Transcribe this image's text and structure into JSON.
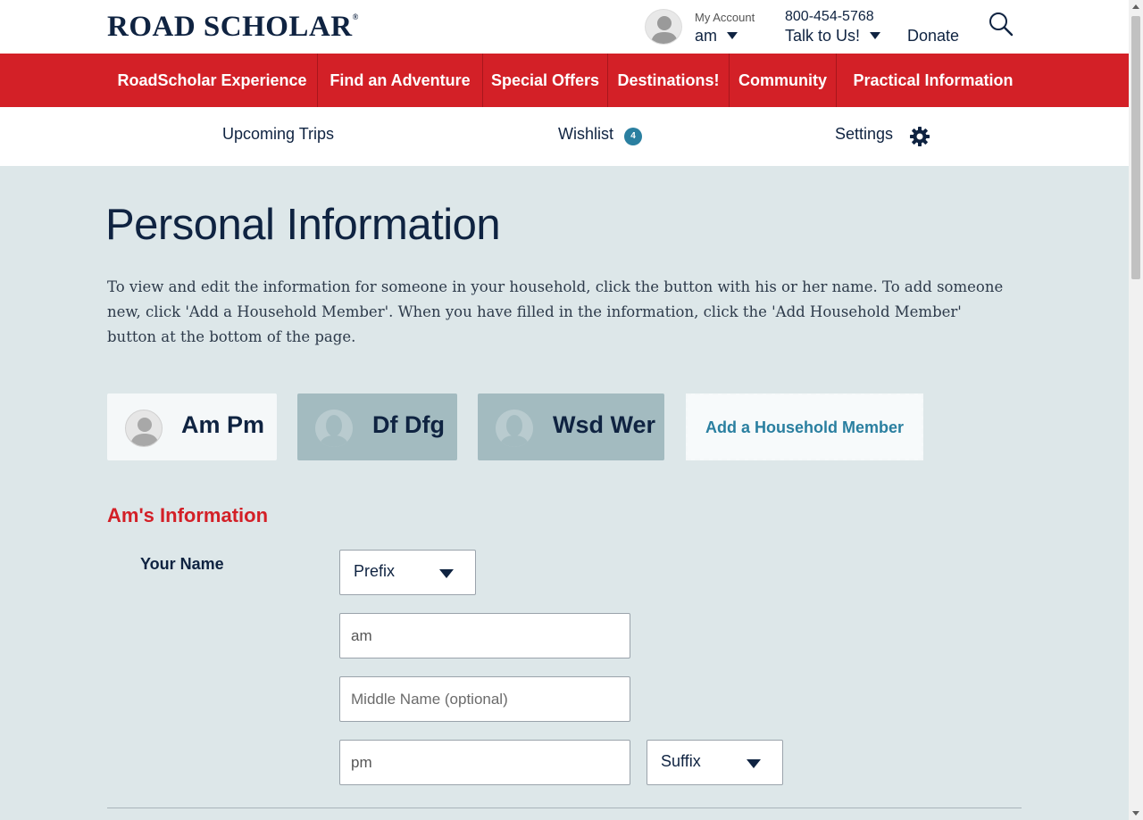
{
  "header": {
    "logo_text": "ROAD SCHOLAR",
    "logo_mark": "®",
    "account": {
      "label": "My Account",
      "name": "am",
      "avatar_icon": "user-silhouette-icon"
    },
    "phone": "800-454-5768",
    "talk_label": "Talk to Us!",
    "donate_label": "Donate",
    "search_icon": "search-icon"
  },
  "nav": {
    "items": [
      {
        "label": "RoadScholar Experience"
      },
      {
        "label": "Find an Adventure"
      },
      {
        "label": "Special Offers"
      },
      {
        "label": "Destinations!"
      },
      {
        "label": "Community"
      },
      {
        "label": "Practical Information"
      }
    ],
    "color": "#d32027"
  },
  "subnav": {
    "upcoming": "Upcoming Trips",
    "wishlist": "Wishlist",
    "wishlist_count": "4",
    "settings": "Settings"
  },
  "page": {
    "title": "Personal Information",
    "intro": "To view and edit the information for someone in your household, click the button with his or her name. To add someone new, click 'Add a Household Member'. When you have filled in the information, click the 'Add Household Member' button at the bottom of the page."
  },
  "household": {
    "members": [
      {
        "name": "Am Pm",
        "active": true
      },
      {
        "name": "Df Dfg",
        "active": false
      },
      {
        "name": "Wsd Wer",
        "active": false
      }
    ],
    "add_label": "Add a Household Member"
  },
  "form": {
    "section_title": "Am's Information",
    "name_label": "Your Name",
    "prefix": {
      "selected": "Prefix"
    },
    "first_name": {
      "value": "am",
      "placeholder": ""
    },
    "middle_name": {
      "value": "",
      "placeholder": "Middle Name (optional)"
    },
    "last_name": {
      "value": "pm",
      "placeholder": ""
    },
    "suffix": {
      "selected": "Suffix"
    }
  },
  "colors": {
    "brand_red": "#d32027",
    "navy": "#0f2341",
    "accent_blue": "#2a7fa0",
    "page_bg": "#dde7e9"
  }
}
